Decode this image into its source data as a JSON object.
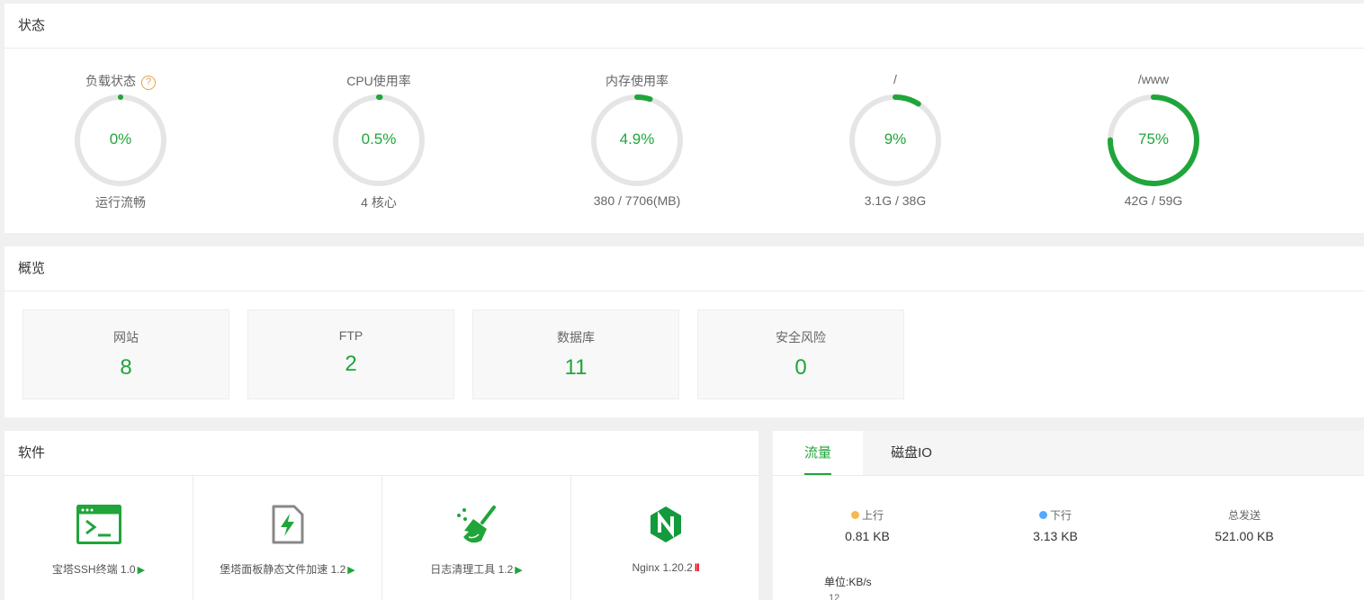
{
  "status": {
    "title": "状态",
    "help_mark": "?",
    "gauges": [
      {
        "title": "负载状态",
        "value": "0%",
        "percent": 0,
        "sub": "运行流畅"
      },
      {
        "title": "CPU使用率",
        "value": "0.5%",
        "percent": 0.5,
        "sub": "4 核心"
      },
      {
        "title": "内存使用率",
        "value": "4.9%",
        "percent": 4.9,
        "sub": "380 / 7706(MB)"
      },
      {
        "title": "/",
        "value": "9%",
        "percent": 9,
        "sub": "3.1G / 38G"
      },
      {
        "title": "/www",
        "value": "75%",
        "percent": 75,
        "sub": "42G / 59G"
      }
    ]
  },
  "overview": {
    "title": "概览",
    "cards": [
      {
        "label": "网站",
        "value": "8"
      },
      {
        "label": "FTP",
        "value": "2"
      },
      {
        "label": "数据库",
        "value": "11"
      },
      {
        "label": "安全风险",
        "value": "0"
      }
    ]
  },
  "software": {
    "title": "软件",
    "items": [
      {
        "name": "宝塔SSH终端 1.0",
        "icon": "terminal-icon",
        "state_icon": "▶"
      },
      {
        "name": "堡塔面板静态文件加速 1.2",
        "icon": "file-bolt-icon",
        "state_icon": "▶"
      },
      {
        "name": "日志清理工具 1.2",
        "icon": "broom-icon",
        "state_icon": "▶"
      },
      {
        "name": "Nginx 1.20.2",
        "icon": "nginx-icon",
        "state_icon": "II"
      }
    ]
  },
  "traffic": {
    "tabs": [
      "流量",
      "磁盘IO"
    ],
    "stats": [
      {
        "label": "上行",
        "value": "0.81 KB",
        "dot_color": "#f7b851"
      },
      {
        "label": "下行",
        "value": "3.13 KB",
        "dot_color": "#52a9ff"
      },
      {
        "label": "总发送",
        "value": "521.00 KB"
      }
    ],
    "unit": "单位:KB/s",
    "first_tick": "12"
  },
  "colors": {
    "accent": "#20a53a",
    "track": "#e5e5e5"
  }
}
